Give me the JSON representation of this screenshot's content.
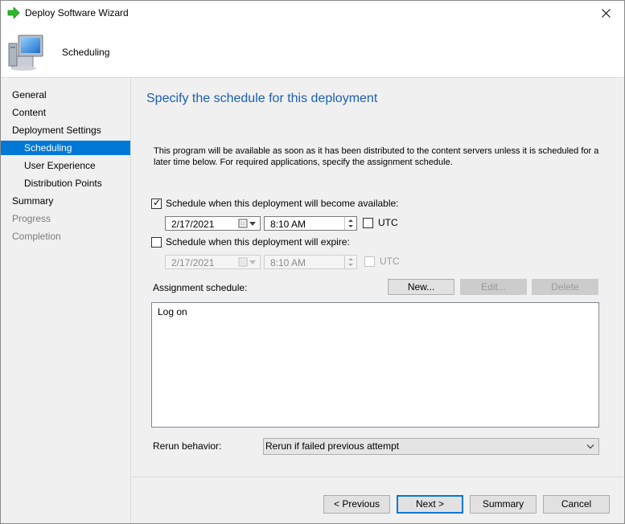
{
  "window": {
    "title": "Deploy Software Wizard"
  },
  "header": {
    "step_title": "Scheduling"
  },
  "nav": {
    "items": [
      {
        "label": "General",
        "state": "normal"
      },
      {
        "label": "Content",
        "state": "normal"
      },
      {
        "label": "Deployment Settings",
        "state": "normal"
      },
      {
        "label": "Scheduling",
        "state": "active"
      },
      {
        "label": "User Experience",
        "state": "normal"
      },
      {
        "label": "Distribution Points",
        "state": "normal"
      },
      {
        "label": "Summary",
        "state": "normal"
      },
      {
        "label": "Progress",
        "state": "disabled"
      },
      {
        "label": "Completion",
        "state": "disabled"
      }
    ]
  },
  "main": {
    "title": "Specify the schedule for this deployment",
    "description": "This program will be available as soon as it has been distributed to the content servers unless it is scheduled for a later time below. For required applications, specify the assignment schedule.",
    "available": {
      "label": "Schedule when this deployment will become available:",
      "checked": true,
      "date": "2/17/2021",
      "time": "8:10 AM",
      "utc_label": "UTC",
      "utc_checked": false
    },
    "expire": {
      "label": "Schedule when this deployment will expire:",
      "checked": false,
      "date": "2/17/2021",
      "time": "8:10 AM",
      "utc_label": "UTC",
      "utc_checked": false
    },
    "assignment": {
      "label": "Assignment schedule:",
      "new_label": "New...",
      "edit_label": "Edit...",
      "delete_label": "Delete",
      "items": [
        "Log on"
      ]
    },
    "rerun": {
      "label": "Rerun behavior:",
      "selected": "Rerun if failed previous attempt"
    }
  },
  "footer": {
    "previous_label": "< Previous",
    "next_label": "Next >",
    "summary_label": "Summary",
    "cancel_label": "Cancel"
  },
  "colors": {
    "accent": "#0078d7",
    "title_blue": "#1a5fb4"
  }
}
